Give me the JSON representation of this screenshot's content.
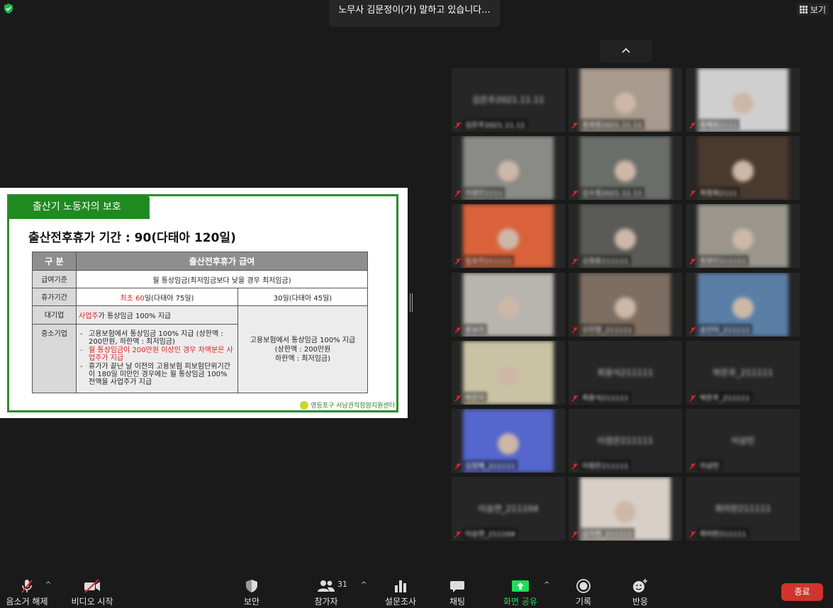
{
  "meeting": {
    "speaking_banner": "노무사 김문정이(가) 말하고 있습니다...",
    "view_label": "보기"
  },
  "slide": {
    "tab_title": "출산기 노동자의 보호",
    "title": "출산전후휴가 기간 : 90(다태아 120일)",
    "table": {
      "header_left": "구  분",
      "header_right": "출산전후휴가 급여",
      "row1_label": "급여기준",
      "row1_value": "월 통상임금(최저임금보다 낮을 경우 최저임금)",
      "row2_label": "휴가기간",
      "row2_left_red": "최초 60",
      "row2_left_rest": "일(다태아 75일)",
      "row2_right": "30일(다태아 45일)",
      "row3_label": "대기업",
      "row3_red": "사업주",
      "row3_rest": "가 통상임금 100% 지급",
      "row4_label": "중소기업",
      "row4_bullets": [
        "고용보험에서 통상임금 100% 지급 (상한액 : 200만원, 하한액 : 최저임금)",
        "월 통상임금이 200만원 이상인 경우 차액분은 사업주가 지급",
        "휴가가 끝난 날 이전의 고용보험 피보험단위기간이 180일 미만인 경우에는 월 통상임금 100% 전액을 사업주가 지급"
      ],
      "right_merged_line1": "고용보험에서 통상임금 100% 지급",
      "right_merged_line2": "(상한액 : 200만원",
      "right_merged_line3": "하한액 : 최저임금)"
    },
    "footer": "영등포구 서남권직장맘지원센터"
  },
  "participants": [
    {
      "center": "김은주2021.11.11",
      "name": "김은주2021.11.11",
      "video": ""
    },
    {
      "center": "",
      "name": "정희정2021.11.11",
      "video": "#a89a8c"
    },
    {
      "center": "",
      "name": "황혜원2111",
      "video": "#cfcfcf"
    },
    {
      "center": "",
      "name": "이정민2111",
      "video": "#8a8a86"
    },
    {
      "center": "",
      "name": "김수정2021.11.11",
      "video": "#6a6e68"
    },
    {
      "center": "",
      "name": "최정희2111",
      "video": "#4a3a2e"
    },
    {
      "center": "",
      "name": "임유진211111",
      "video": "#d9623a"
    },
    {
      "center": "",
      "name": "김정윤211111",
      "video": "#5a5a56"
    },
    {
      "center": "",
      "name": "정영인211111",
      "video": "#9a968c"
    },
    {
      "center": "",
      "name": "윤보라",
      "video": "#b8b4ae"
    },
    {
      "center": "",
      "name": "오민영_211111",
      "video": "#7e6e62"
    },
    {
      "center": "",
      "name": "송인아_211111",
      "video": "#5a7ea6"
    },
    {
      "center": "",
      "name": "박은지",
      "video": "#c9c2a4"
    },
    {
      "center": "최윤식211111",
      "name": "최윤식211111",
      "video": ""
    },
    {
      "center": "박은주_211111",
      "name": "박은주_211111",
      "video": ""
    },
    {
      "center": "",
      "name": "김정혜_211111",
      "video": "#5566cc"
    },
    {
      "center": "이정은211111",
      "name": "이정은211111",
      "video": ""
    },
    {
      "center": "이상민",
      "name": "이상민",
      "video": ""
    },
    {
      "center": "이승연_211104",
      "name": "이승연_211104",
      "video": ""
    },
    {
      "center": "",
      "name": "김지현_211111",
      "video": "#d8cfc6"
    },
    {
      "center": "최미란211111",
      "name": "최미란211111",
      "video": ""
    }
  ],
  "toolbar": {
    "unmute": "음소거 해제",
    "start_video": "비디오 시작",
    "security": "보안",
    "participants": "참가자",
    "participants_count": "31",
    "polls": "설문조사",
    "chat": "채팅",
    "share_screen": "화면 공유",
    "record": "기록",
    "reactions": "반응",
    "end": "종료"
  },
  "colors": {
    "share_green": "#23d959",
    "end_red": "#d0342c",
    "slide_green": "#1f8a1f",
    "mute_red": "#e0262b"
  }
}
